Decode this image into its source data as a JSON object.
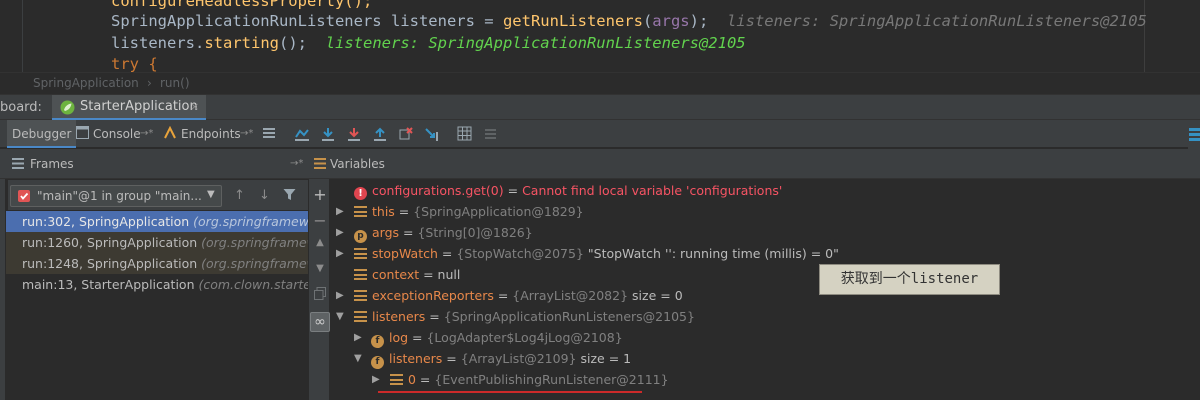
{
  "editor": {
    "line0": "configureHeadlessProperty();",
    "line1": {
      "type": "SpringApplicationRunListeners",
      "var": "listeners",
      "call": "getRunListeners",
      "arg": "args",
      "hint": "listeners: SpringApplicationRunListeners@2105"
    },
    "line2": {
      "var": "listeners",
      "call": "starting",
      "hint": "listeners: SpringApplicationRunListeners@2105"
    },
    "line3": "try {"
  },
  "breadcrumb": {
    "class": "SpringApplication",
    "sep": "›",
    "method": "run()"
  },
  "dashboard": {
    "label": "board:",
    "tab": "StarterApplication",
    "close": "×"
  },
  "toolbar": {
    "debugger": "Debugger",
    "console": "Console",
    "endpoints": "Endpoints",
    "pin": "→*"
  },
  "frames": {
    "title": "Frames",
    "thread": "\"main\"@1 in group \"main...",
    "items": [
      {
        "method": "run:302, SpringApplication ",
        "pkg": "(org.springframework"
      },
      {
        "method": "run:1260, SpringApplication ",
        "pkg": "(org.springframewor"
      },
      {
        "method": "run:1248, SpringApplication ",
        "pkg": "(org.springframewor"
      },
      {
        "method": "main:13, StarterApplication ",
        "pkg": "(com.clown.starter)"
      }
    ]
  },
  "variables": {
    "title": "Variables",
    "eq": " = ",
    "rows": [
      {
        "name": "configurations.get(0)",
        "value": "Cannot find local variable 'configurations'"
      },
      {
        "name": "this",
        "value": "{SpringApplication@1829}"
      },
      {
        "name": "args",
        "value": "{String[0]@1826}"
      },
      {
        "name": "stopWatch",
        "value": "{StopWatch@2075}",
        "extra": "\"StopWatch '': running time (millis) = 0\""
      },
      {
        "name": "context",
        "value": "null"
      },
      {
        "name": "exceptionReporters",
        "value": "{ArrayList@2082}",
        "extra": "size = 0"
      },
      {
        "name": "listeners",
        "value": "{SpringApplicationRunListeners@2105}"
      },
      {
        "name": "log",
        "value": "{LogAdapter$Log4jLog@2108}"
      },
      {
        "name": "listeners",
        "value": "{ArrayList@2109}",
        "extra": "size = 1"
      },
      {
        "name": "0",
        "value": "{EventPublishingRunListener@2111}"
      }
    ]
  },
  "annotation": "获取到一个listener",
  "colors": {
    "selected_frame": "#4b6eaf",
    "variable_name": "#e8884a",
    "error": "#f75464",
    "hint_green": "#62d34e",
    "annotation_bg": "#d5d2c2",
    "underline": "#cc2a2a"
  }
}
